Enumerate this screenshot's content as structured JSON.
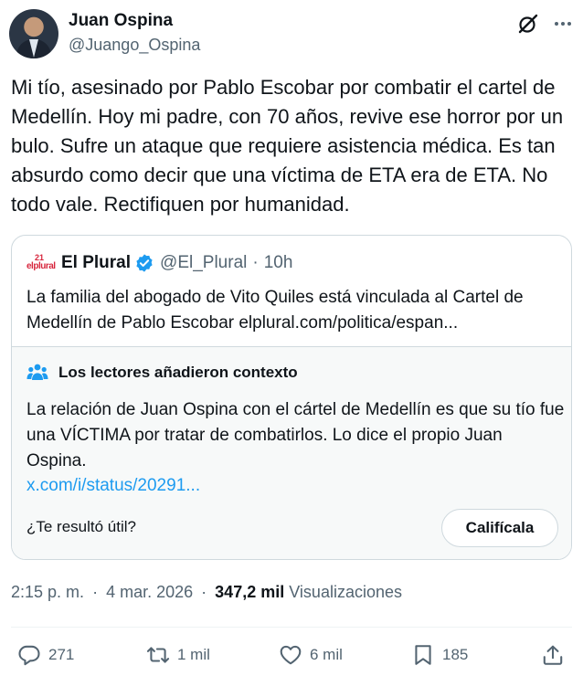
{
  "author": {
    "name": "Juan Ospina",
    "handle": "@Juango_Ospina"
  },
  "tweet": {
    "text": "Mi tío, asesinado por Pablo Escobar por combatir el cartel de Medellín. Hoy mi padre, con 70 años, revive ese horror por un bulo. Sufre un ataque que requiere asistencia médica. Es tan absurdo como decir que una víctima de ETA era de ETA. No todo vale. Rectifiquen por humanidad."
  },
  "quote": {
    "logo_top": "21",
    "logo_word": "elplural",
    "name": "El Plural",
    "handle": "@El_Plural",
    "separator": "·",
    "time": "10h",
    "text": "La familia del abogado de Vito Quiles está vinculada al Cartel de Medellín de Pablo Escobar elplural.com/politica/espan..."
  },
  "community_note": {
    "title": "Los lectores añadieron contexto",
    "text": "La relación de Juan Ospina con el cártel de Medellín es que su tío fue una VÍCTIMA por tratar de combatirlos. Lo dice el propio Juan Ospina.",
    "link": "x.com/i/status/20291...",
    "question": "¿Te resultó útil?",
    "rate_label": "Califícala"
  },
  "meta": {
    "time": "2:15 p. m.",
    "sep1": "·",
    "date": "4 mar. 2026",
    "sep2": "·",
    "views": "347,2 mil",
    "views_label": "Visualizaciones"
  },
  "actions": {
    "replies": "271",
    "reposts": "1 mil",
    "likes": "6 mil",
    "bookmarks": "185"
  },
  "icons": {
    "grok": "grok-icon",
    "more": "more-icon",
    "verified": "verified-badge-icon",
    "people": "people-icon",
    "reply": "reply-icon",
    "repost": "repost-icon",
    "like": "heart-icon",
    "bookmark": "bookmark-icon",
    "share": "share-icon"
  },
  "colors": {
    "text": "#0f1419",
    "secondary": "#536471",
    "link": "#1d9bf0",
    "border": "#cfd9de",
    "note_bg": "#f7f9f9"
  }
}
